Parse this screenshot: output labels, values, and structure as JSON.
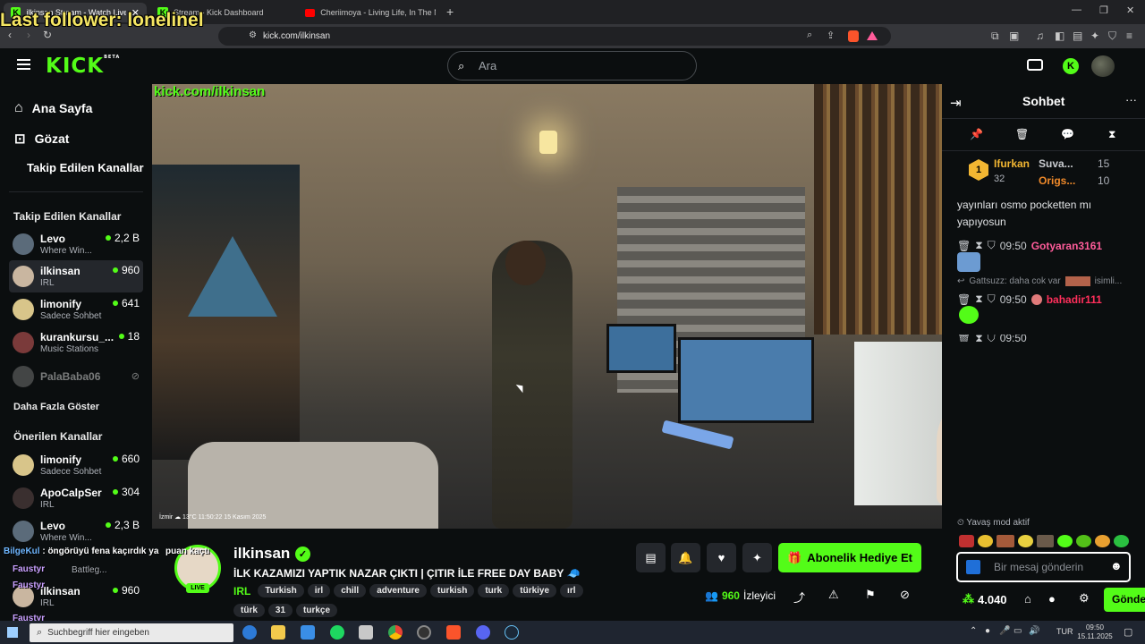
{
  "browser": {
    "tabs": [
      {
        "label": "ilkinsan Stream - Watch Live -"
      },
      {
        "label": "Stream - Kick Dashboard"
      },
      {
        "label": "Cheriimoya - Living Life, In The Night"
      }
    ],
    "url": "kick.com/ilkinsan"
  },
  "overlay": {
    "last_follower": "Last follower: lonelinel",
    "video_watermark": "kick.com/ilkinsan",
    "video_caption": "İzmir ☁ 13°C  11:50:22  15 Kasım 2025"
  },
  "header": {
    "search_placeholder": "Ara"
  },
  "sidebar": {
    "nav": [
      {
        "label": "Ana Sayfa"
      },
      {
        "label": "Gözat"
      },
      {
        "label": "Takip Edilen Kanallar"
      }
    ],
    "followed_title": "Takip Edilen Kanallar",
    "followed": [
      {
        "name": "Levo",
        "category": "Where Win...",
        "viewers": "2,2 B"
      },
      {
        "name": "ilkinsan",
        "category": "IRL",
        "viewers": "960"
      },
      {
        "name": "limonify",
        "category": "Sadece Sohbet",
        "viewers": "641"
      },
      {
        "name": "kurankursu_...",
        "category": "Music Stations",
        "viewers": "18"
      },
      {
        "name": "PalaBaba06",
        "category": "",
        "viewers": ""
      }
    ],
    "show_more": "Daha Fazla Göster",
    "recommended_title": "Önerilen Kanallar",
    "recommended": [
      {
        "name": "limonify",
        "category": "Sadece Sohbet",
        "viewers": "660"
      },
      {
        "name": "ApoCalpSer",
        "category": "IRL",
        "viewers": "304"
      },
      {
        "name": "Levo",
        "category": "Where Win...",
        "viewers": "2,3 B"
      },
      {
        "name": "ilkinsan",
        "category": "IRL",
        "viewers": "960"
      }
    ]
  },
  "chat": {
    "title": "Sohbet",
    "leaders": [
      {
        "name": "Ifurkan",
        "count": "32"
      },
      {
        "name": "Suva...",
        "count": "15"
      },
      {
        "name": "Origs...",
        "count": "10"
      }
    ],
    "message_tail": "yayınları osmo pocketten mı yapıyosun",
    "messages": [
      {
        "time": "09:50",
        "user": "Gotyaran3161",
        "color": "#ff5c9a"
      },
      {
        "reply": "Gattsuzz: daha cok var",
        "reply_tail": "isimli..."
      },
      {
        "time": "09:50",
        "user": "bahadir111",
        "color": "#ff2f5b"
      },
      {
        "time": "09:50",
        "user": "",
        "color": "#ffffff"
      }
    ],
    "slow_mode": "Yavaş mod aktif",
    "input_placeholder": "Bir mesaj gönderin",
    "points": "4.040",
    "send_label": "Gönde"
  },
  "stream": {
    "channel": "ilkinsan",
    "live_badge": "LIVE",
    "title": "İLK KAZAMIZI YAPTIK NAZAR ÇIKTI | ÇITIR İLE FREE DAY BABY 🧢",
    "category": "IRL",
    "tags_row1": [
      "Turkish",
      "irl",
      "chill",
      "adventure",
      "turkish",
      "turk",
      "türkiye",
      "ırl"
    ],
    "tags_row2": [
      "türk",
      "31",
      "turkçe"
    ],
    "viewers": "960",
    "viewers_label": "İzleyici",
    "subscribe_label": "Abonelik Hediye Et",
    "overlay_points": "puan kaçtı"
  },
  "stream_overlay_left": {
    "lines": [
      {
        "user": "BilgeKul",
        "text": "öngörüyü fena kaçırdık ya"
      },
      {
        "user": "Faustyr",
        "text": "Battleg..."
      },
      {
        "user": "Faustyr",
        "text": ""
      },
      {
        "user": "Faustyr",
        "text": ""
      }
    ]
  },
  "taskbar": {
    "search": "Suchbegriff hier eingeben",
    "lang": "TUR",
    "time": "09:50",
    "date": "15.11.2025"
  },
  "colors": {
    "brand": "#53fc18",
    "background": "#0b0e0f",
    "overlay_text": "#f5e663"
  }
}
